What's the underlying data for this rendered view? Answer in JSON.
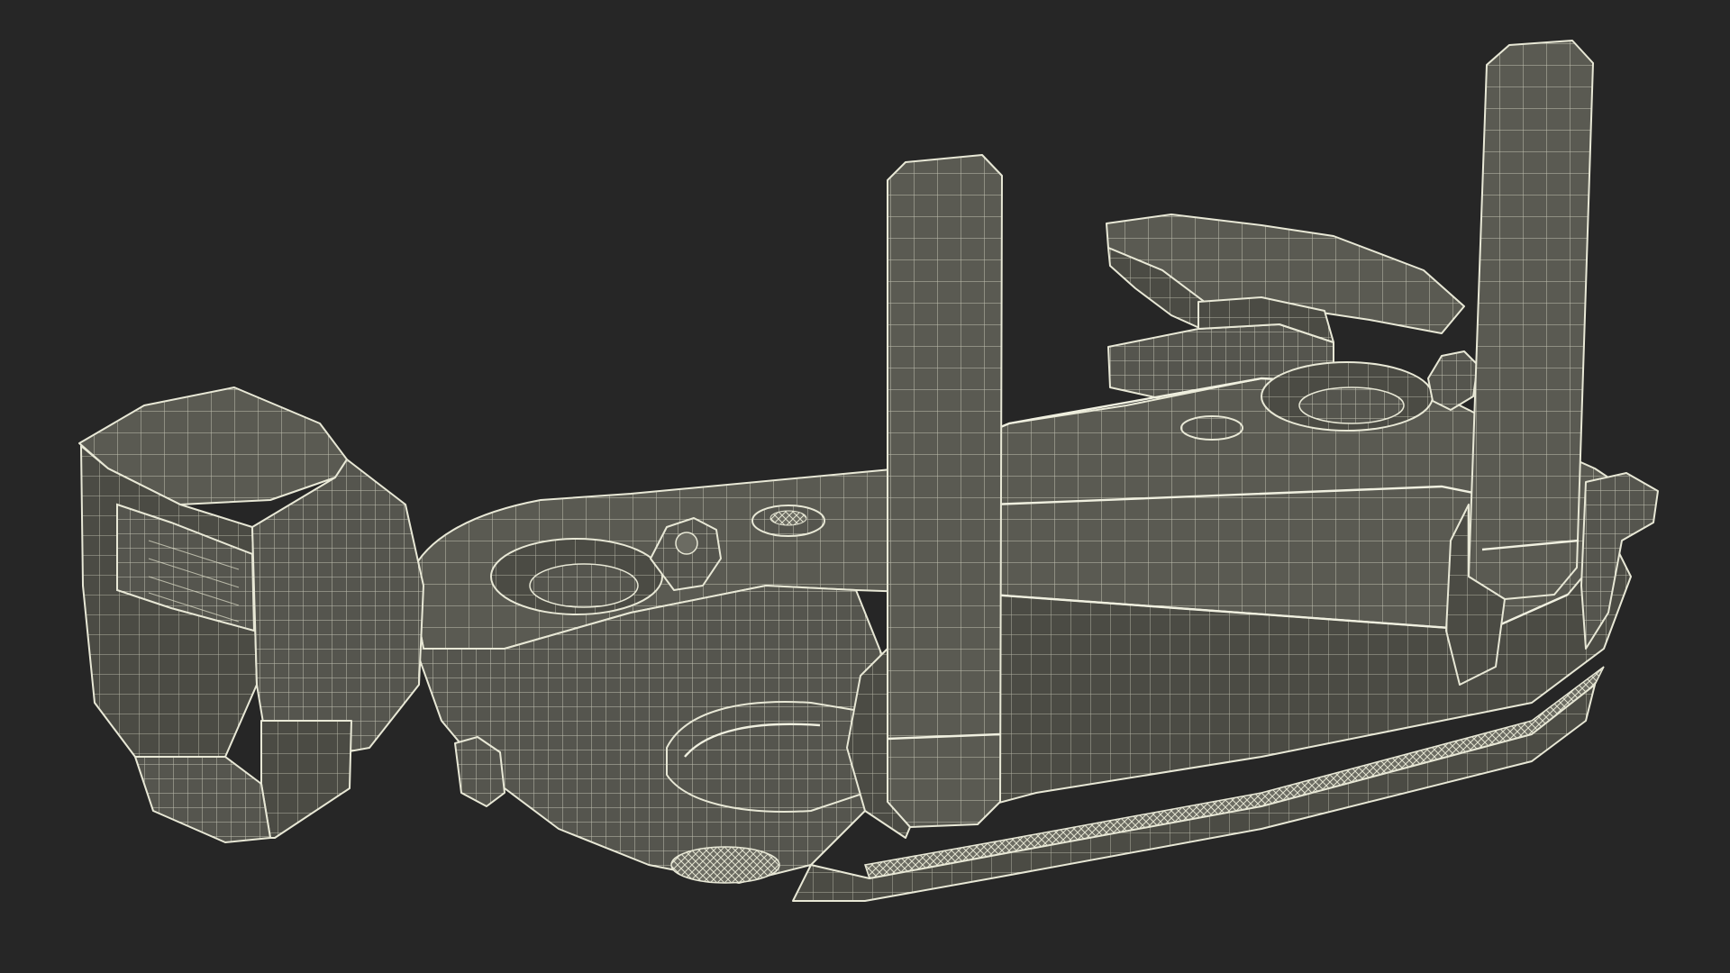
{
  "scene": {
    "background_color": "#262626",
    "mesh_fill_color": "#5a5a52",
    "mesh_fill_dark": "#4a4a43",
    "wire_color": "#e8e8d6"
  }
}
